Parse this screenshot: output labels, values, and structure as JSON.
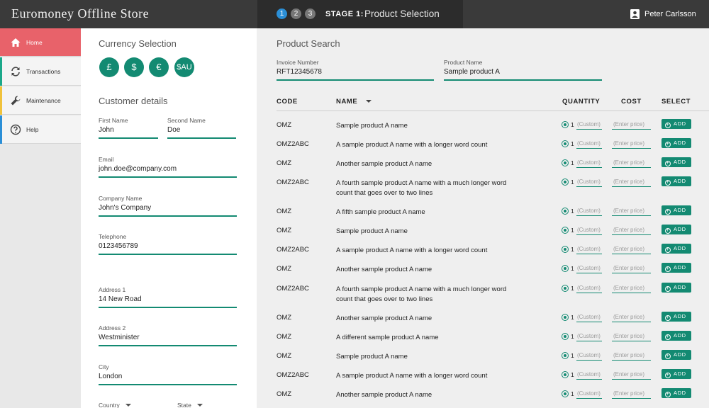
{
  "header": {
    "brand": "Euromoney Offline Store",
    "steps": [
      "1",
      "2",
      "3"
    ],
    "stage_label": "STAGE 1:",
    "stage_title": "Product Selection",
    "user_name": "Peter Carlsson"
  },
  "sidebar": {
    "items": [
      {
        "label": "Home",
        "icon": "home-icon",
        "accent": "#e8626a"
      },
      {
        "label": "Transactions",
        "icon": "refresh-icon",
        "accent": "#1ba88a"
      },
      {
        "label": "Maintenance",
        "icon": "wrench-icon",
        "accent": "#f0c23c"
      },
      {
        "label": "Help",
        "icon": "help-icon",
        "accent": "#2b8fd7"
      }
    ]
  },
  "currency": {
    "title": "Currency Selection",
    "buttons": [
      "£",
      "$",
      "€",
      "$AU"
    ]
  },
  "customer": {
    "title": "Customer details",
    "first_name": {
      "label": "First Name",
      "value": "John"
    },
    "second_name": {
      "label": "Second Name",
      "value": "Doe"
    },
    "email": {
      "label": "Email",
      "value": "john.doe@company.com"
    },
    "company": {
      "label": "Company Name",
      "value": "John's Company"
    },
    "telephone": {
      "label": "Telephone",
      "value": "0123456789"
    },
    "address1": {
      "label": "Address 1",
      "value": "14 New Road"
    },
    "address2": {
      "label": "Address 2",
      "value": "Westminister"
    },
    "city": {
      "label": "City",
      "value": "London"
    },
    "country": {
      "label": "Country"
    },
    "state": {
      "label": "State"
    }
  },
  "search": {
    "title": "Product Search",
    "invoice": {
      "label": "Invoice Number",
      "value": "RFT12345678"
    },
    "product_name": {
      "label": "Product Name",
      "value": "Sample product A"
    }
  },
  "table": {
    "headers": {
      "code": "CODE",
      "name": "NAME",
      "quantity": "QUANTITY",
      "cost": "COST",
      "select": "SELECT"
    },
    "quantity_default": "1",
    "custom_placeholder": "(Custom)",
    "price_placeholder": "(Enter price)",
    "add_label": "ADD",
    "rows": [
      {
        "code": "OMZ",
        "name": "Sample product A name"
      },
      {
        "code": "OMZ2ABC",
        "name": "A sample product A name with a longer word count"
      },
      {
        "code": "OMZ",
        "name": "Another sample product A name"
      },
      {
        "code": "OMZ2ABC",
        "name": "A fourth sample product A name with a much longer word count that goes over to two lines"
      },
      {
        "code": "OMZ",
        "name": "A fifth sample product A name"
      },
      {
        "code": "OMZ",
        "name": "Sample product A name"
      },
      {
        "code": "OMZ2ABC",
        "name": "A sample product A name with a longer word count"
      },
      {
        "code": "OMZ",
        "name": "Another sample product A name"
      },
      {
        "code": "OMZ2ABC",
        "name": "A fourth sample product A name with a much longer word count that goes over to two lines"
      },
      {
        "code": "OMZ",
        "name": "Another sample product A name"
      },
      {
        "code": "OMZ",
        "name": "A different sample product A name"
      },
      {
        "code": "OMZ",
        "name": "Sample product A name"
      },
      {
        "code": "OMZ2ABC",
        "name": "A sample product A name with a longer word count"
      },
      {
        "code": "OMZ",
        "name": "Another sample product A name"
      }
    ]
  },
  "colors": {
    "accent": "#138a72",
    "header_bg": "#3a3a3a",
    "active_step": "#2b8fd7"
  }
}
